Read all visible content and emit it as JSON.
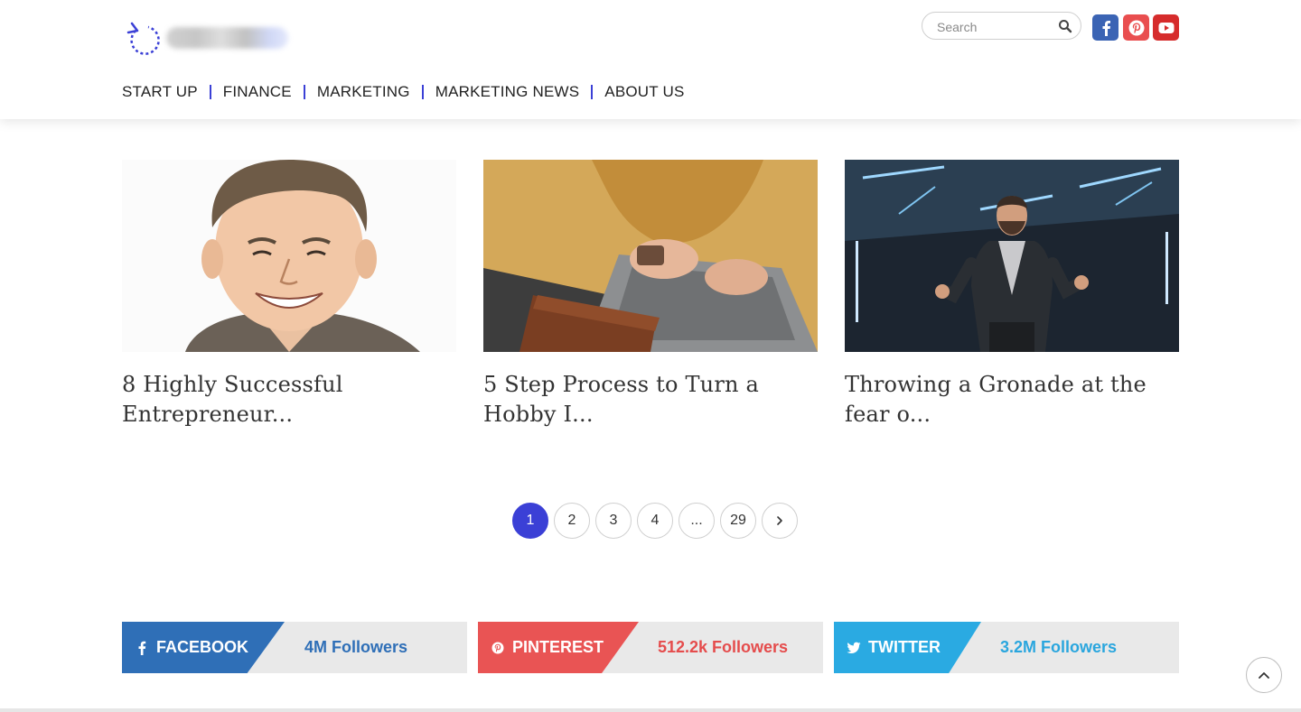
{
  "header": {
    "search": {
      "placeholder": "Search"
    },
    "social": [
      "facebook-icon",
      "pinterest-icon",
      "youtube-icon"
    ],
    "nav": [
      "START UP",
      "FINANCE",
      "MARKETING",
      "MARKETING NEWS",
      "ABOUT US"
    ]
  },
  "posts": [
    {
      "title": "8 Highly Successful Entrepreneur...",
      "image": "cartoon portrait of smiling man"
    },
    {
      "title": "5 Step Process to Turn a Hobby I...",
      "image": "person typing on laptop"
    },
    {
      "title": "Throwing a Gronade at the fear o...",
      "image": "speaker on stage"
    }
  ],
  "pagination": {
    "pages": [
      "1",
      "2",
      "3",
      "4",
      "...",
      "29"
    ],
    "current": "1",
    "next_icon": "chevron-right-icon"
  },
  "social_bars": [
    {
      "name": "FACEBOOK",
      "count": "4M Followers",
      "color": "#2f6fb7"
    },
    {
      "name": "PINTEREST",
      "count": "512.2k Followers",
      "color": "#e95454"
    },
    {
      "name": "TWITTER",
      "count": "3.2M Followers",
      "color": "#2aaae2"
    }
  ],
  "colors": {
    "accent": "#3b40d6",
    "facebook": "#3b64b4",
    "pinterest": "#e94e4f",
    "youtube": "#d62c2c"
  }
}
